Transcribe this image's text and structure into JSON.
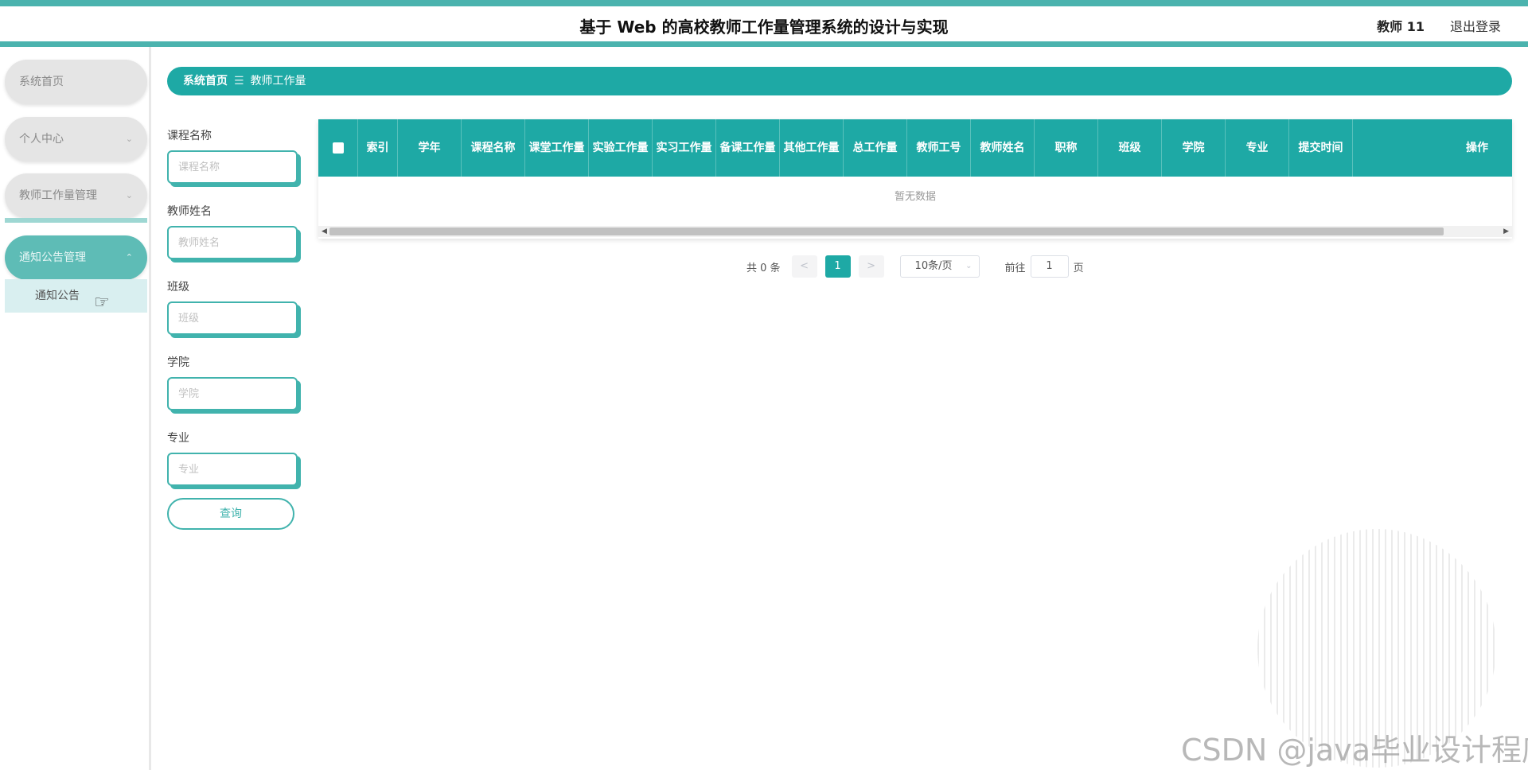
{
  "header": {
    "title": "基于 Web 的高校教师工作量管理系统的设计与实现",
    "user": "教师 11",
    "logout": "退出登录"
  },
  "sidebar": {
    "items": [
      {
        "label": "系统首页"
      },
      {
        "label": "个人中心"
      },
      {
        "label": "教师工作量管理"
      },
      {
        "label": "通知公告管理"
      }
    ],
    "submenu": {
      "label": "通知公告"
    }
  },
  "breadcrumb": {
    "home": "系统首页",
    "sep": "☰",
    "current": "教师工作量"
  },
  "search": {
    "fields": [
      {
        "label": "课程名称",
        "placeholder": "课程名称"
      },
      {
        "label": "教师姓名",
        "placeholder": "教师姓名"
      },
      {
        "label": "班级",
        "placeholder": "班级"
      },
      {
        "label": "学院",
        "placeholder": "学院"
      },
      {
        "label": "专业",
        "placeholder": "专业"
      }
    ],
    "button": "查询"
  },
  "table": {
    "columns": [
      "索引",
      "学年",
      "课程名称",
      "课堂工作量",
      "实验工作量",
      "实习工作量",
      "备课工作量",
      "其他工作量",
      "总工作量",
      "教师工号",
      "教师姓名",
      "职称",
      "班级",
      "学院",
      "专业",
      "提交时间",
      "操作"
    ],
    "empty": "暂无数据"
  },
  "pagination": {
    "total": "共 0 条",
    "prev": "<",
    "page": "1",
    "next": ">",
    "page_size": "10条/页",
    "goto": "前往",
    "goto_value": "1",
    "page_unit": "页"
  },
  "watermark": "CSDN @java毕业设计程序"
}
